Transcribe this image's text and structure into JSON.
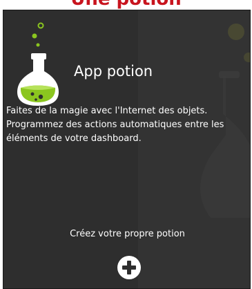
{
  "header": {
    "title": "Une potion"
  },
  "card": {
    "app_title": "App potion",
    "description_lines": [
      "Faites de la magie avec l'Internet des objets.",
      "Programmez des actions automatiques entre les",
      "éléments de votre dashboard."
    ],
    "create_label": "Créez votre propre potion",
    "add_icon": "plus-circle-icon",
    "flask_icon": "potion-flask-icon"
  },
  "colors": {
    "title_red": "#c8141e",
    "card_bg": "#2e2e2e",
    "accent_green": "#8bc61f",
    "text": "#ffffff"
  }
}
